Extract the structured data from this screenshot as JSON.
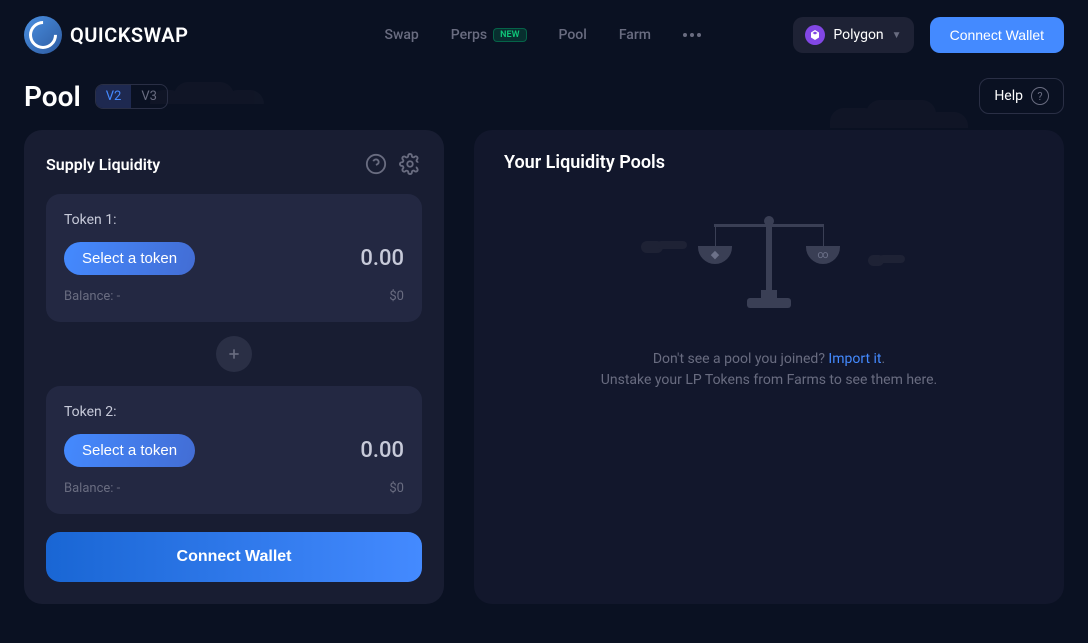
{
  "logo": {
    "text": "QUICKSWAP"
  },
  "nav": {
    "swap": "Swap",
    "perps": "Perps",
    "perps_badge": "NEW",
    "pool": "Pool",
    "farm": "Farm"
  },
  "network": {
    "label": "Polygon"
  },
  "header_connect": "Connect Wallet",
  "page": {
    "title": "Pool",
    "tabs": {
      "v2": "V2",
      "v3": "V3"
    },
    "help": "Help"
  },
  "supply": {
    "title": "Supply Liquidity",
    "token1": {
      "label": "Token 1:",
      "select": "Select a token",
      "amount": "0.00",
      "balance_label": "Balance: -",
      "balance_value": "$0"
    },
    "token2": {
      "label": "Token 2:",
      "select": "Select a token",
      "amount": "0.00",
      "balance_label": "Balance: -",
      "balance_value": "$0"
    },
    "connect": "Connect Wallet"
  },
  "pools": {
    "title": "Your Liquidity Pools",
    "empty": {
      "line1_prefix": "Don't see a pool you joined? ",
      "import": "Import it",
      "line1_suffix": ".",
      "line2": "Unstake your LP Tokens from Farms to see them here."
    }
  }
}
